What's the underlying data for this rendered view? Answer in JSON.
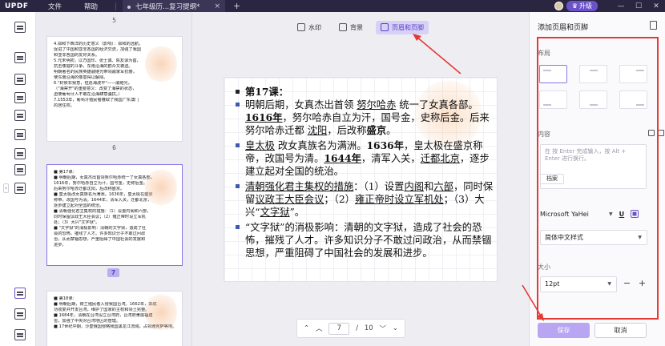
{
  "app": {
    "logo": "UPDF",
    "menu": [
      "文件",
      "帮助"
    ],
    "tab_title": "七年级历...复习提纲*",
    "tab_close": "×",
    "tab_add": "+",
    "upgrade_label": "升级"
  },
  "thumbnails": {
    "page5_label": "5",
    "page6_label": "6",
    "page7_label": "7",
    "page5_lines": [
      "4.郑和下西洋的历史意义（影响）：郑和的远航，",
      "促进了中国和亚非各国的经济交流，加强了我国",
      "和亚非各国的友好关系。",
      "5.元末明初，以方国珍、张士诚、陈友谅为首，",
      "抗击倭寇的斗争，东南沿海的群众又被迫。",
      "明朝著名的民族英雄戚继光带领戚家军抗倭，",
      "使东南沿海的倭患得以解除。",
      "6.\"封侯非我意，但愿海波平\"——戚继光。",
      "（\"海禁开\"的重要意义：改变了海禁的状态，",
      "迫使葡萄牙人不敢在沿海肆意骚扰。）",
      "7.1553年，葡萄牙殖民者攫取了我国广东澳门",
      "的居住权。"
    ],
    "page6_lines": [
      "■ 第17课：",
      "■ 明朝后期，女真杰出首领努尔哈赤统一了女真各部。",
      "  1616年，努尔哈赤自立为汗，国号金，史称后金。",
      "  后来努尔哈赤迁都沈阳，后改称盛京。",
      "■ 皇太极改女真族名为满洲。1636年，皇太极在盛京",
      "  称帝，改国号为清。1644年，清军入关，迁都北京，",
      "  逐步建立起对全国的统治。",
      "■ 清朝强化君主集权的措施：（1）设置内阁和六部，",
      "  同时保留议政王大臣会议；（2）雍正帝时设立军机",
      "  处；（3）大兴\"文字狱\"。",
      "■ \"文字狱\"的消极影响：清朝的文字狱，造成了社",
      "  会的恐怖，摧残了人才。许多知识分子不敢过问政",
      "  治，从而禁锢思想，严重阻碍了中国社会的发展和",
      "  进步。"
    ],
    "page7_lines": [
      "■ 第18课：",
      "■ 明朝后期，荷兰殖民者入侵我国台湾。1662年，郑成",
      "  功收复并开发台湾，维护了国家的主权和领土完整。",
      "■ 1684年，清朝在台湾设立台湾府，台湾府隶属福建",
      "  省，加强了中央对台湾地区的管辖。",
      "■ 17世纪中期，沙皇俄国侵略我国黑龙江流域，占领雅克萨等地。"
    ]
  },
  "toolbar": {
    "watermark": "水印",
    "background": "背景",
    "header_footer": "页眉和页脚"
  },
  "document": {
    "lesson_title": "第17课：",
    "p1": {
      "a": "明朝后期，女真杰出首领 ",
      "b": "努尔哈赤",
      "c": " 统一了女真各部。",
      "d": "1616年",
      "e": "，努尔哈赤自立为汗，国号金，史称后金。后来努尔哈赤迁都 ",
      "f": "沈阳",
      "g": "，后改称",
      "h": "盛京",
      "i": "。"
    },
    "p2": {
      "a": "皇太极",
      "b": " 改女真族名为满洲。",
      "c": "1636年",
      "d": "，皇太极在盛京称帝，改国号为清。",
      "e": "1644年",
      "f": "，清军入关，",
      "g": "迁都北京",
      "h": "，逐步建立起对全国的统治。"
    },
    "p3": {
      "a": "清朝强化君主集权的措施",
      "b": "：（1）设置",
      "c": "内阁",
      "d": "和",
      "e": "六部",
      "f": "，同时保留",
      "g": "议政王大臣会议",
      "h": "；（2）",
      "i": "雍正帝时设立军机处",
      "j": "；（3）大兴“",
      "k": "文字狱",
      "l": "”。"
    },
    "p4": {
      "a": "“文字狱”的消极影响：清朝的文字狱，造成了社会的恐怖，摧残了人才。许多知识分子不敢过问政治，从而禁锢思想，严重阻碍了中国社会的发展和进步。"
    }
  },
  "page_nav": {
    "current": "7",
    "separator": "/",
    "total": "10"
  },
  "right_panel": {
    "title": "添加页眉和页脚",
    "layout_label": "布局",
    "content_label": "内容",
    "content_placeholder": "按 Enter 完成输入，按 Alt + Enter 进行换行。",
    "content_prefix": "在",
    "page_number_button": "档案",
    "font_name": "Microsoft YaHei",
    "font_underline": "U",
    "script_select": "简体中文样式",
    "size_label": "大小",
    "size_value": "12pt",
    "size_minus": "−",
    "size_plus": "+",
    "save_label": "保存",
    "cancel_label": "取消"
  },
  "colors": {
    "accent": "#6b52c8",
    "annotation_red": "#e53935",
    "titlebar": "#2a2540"
  }
}
